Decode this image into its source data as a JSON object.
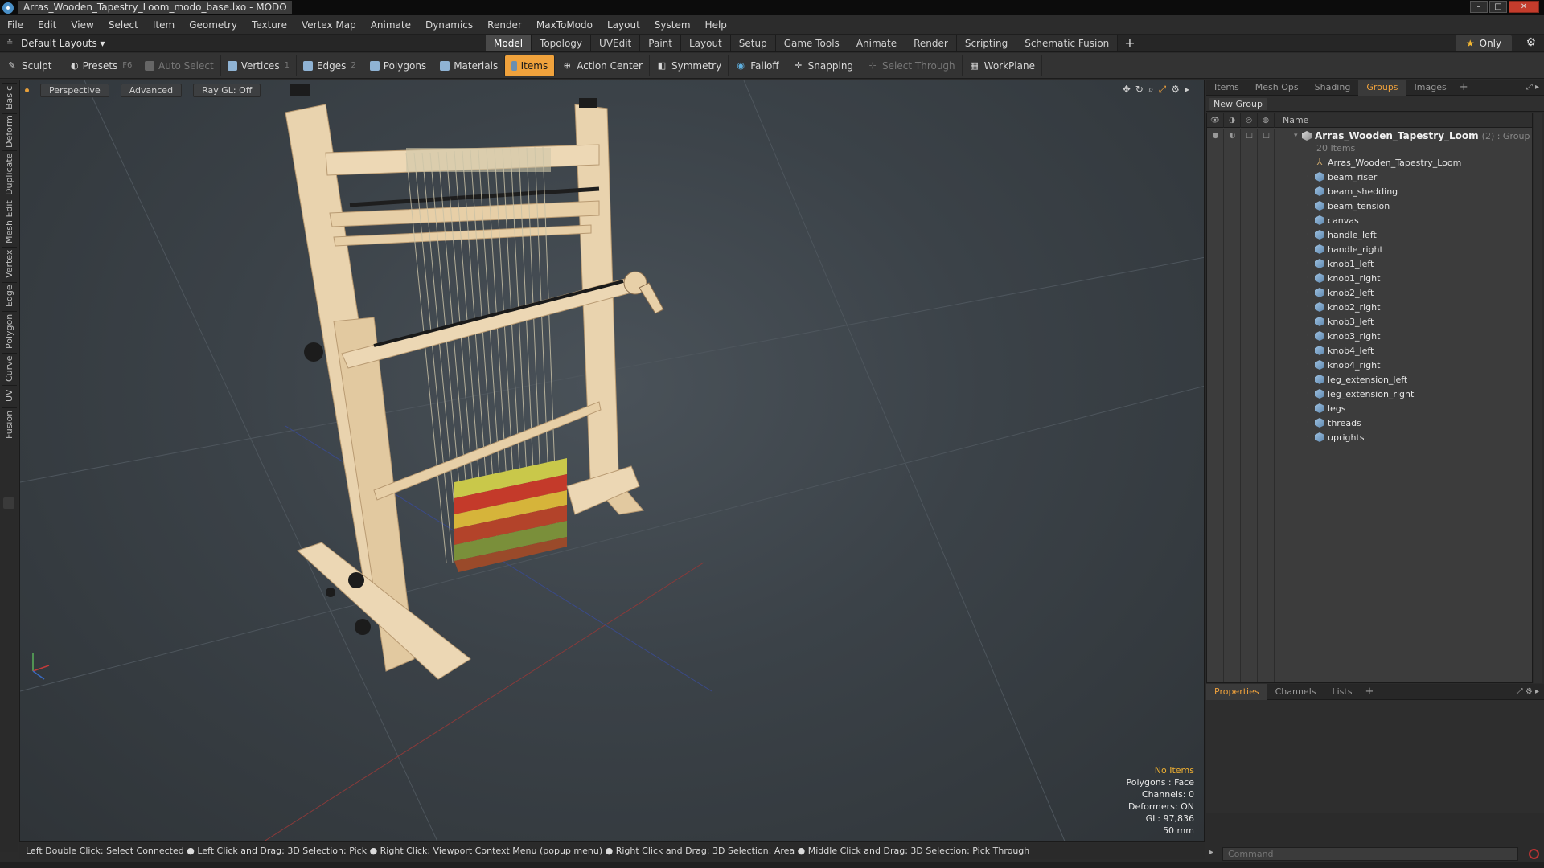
{
  "window": {
    "title": "Arras_Wooden_Tapestry_Loom_modo_base.lxo - MODO",
    "minimize": "–",
    "maximize": "□",
    "close": "✕"
  },
  "menu": [
    "File",
    "Edit",
    "View",
    "Select",
    "Item",
    "Geometry",
    "Texture",
    "Vertex Map",
    "Animate",
    "Dynamics",
    "Render",
    "MaxToModo",
    "Layout",
    "System",
    "Help"
  ],
  "layouts": {
    "label": "Default Layouts ▾"
  },
  "tabs": [
    "Model",
    "Topology",
    "UVEdit",
    "Paint",
    "Layout",
    "Setup",
    "Game Tools",
    "Animate",
    "Render",
    "Scripting",
    "Schematic Fusion"
  ],
  "active_tab": "Model",
  "tab_add": "+",
  "only_label": "Only",
  "toolbar": {
    "sculpt": "Sculpt",
    "presets": "Presets",
    "presets_key": "F6",
    "auto_select": "Auto Select",
    "vertices": "Vertices",
    "vertices_key": "1",
    "edges": "Edges",
    "edges_key": "2",
    "polygons": "Polygons",
    "materials": "Materials",
    "items": "Items",
    "action_center": "Action Center",
    "symmetry": "Symmetry",
    "falloff": "Falloff",
    "snapping": "Snapping",
    "select_through": "Select Through",
    "workplane": "WorkPlane"
  },
  "left_tabs": [
    "Basic",
    "Deform",
    "Duplicate",
    "Mesh Edit",
    "Vertex",
    "Edge",
    "Polygon",
    "Curve",
    "UV",
    "Fusion"
  ],
  "viewport": {
    "perspective": "Perspective",
    "advanced": "Advanced",
    "raygl": "Ray GL: Off",
    "info": {
      "no_items": "No Items",
      "polygons": "Polygons : Face",
      "channels": "Channels: 0",
      "deformers": "Deformers: ON",
      "gl": "GL: 97,836",
      "focal": "50 mm"
    }
  },
  "right_tabs": [
    "Items",
    "Mesh Ops",
    "Shading",
    "Groups",
    "Images"
  ],
  "right_active": "Groups",
  "new_group": "New Group",
  "tree": {
    "name_header": "Name",
    "group": {
      "name": "Arras_Wooden_Tapestry_Loom",
      "count": "(2) : Group",
      "items": "20 Items"
    },
    "children": [
      "Arras_Wooden_Tapestry_Loom",
      "beam_riser",
      "beam_shedding",
      "beam_tension",
      "canvas",
      "handle_left",
      "handle_right",
      "knob1_left",
      "knob1_right",
      "knob2_left",
      "knob2_right",
      "knob3_left",
      "knob3_right",
      "knob4_left",
      "knob4_right",
      "leg_extension_left",
      "leg_extension_right",
      "legs",
      "threads",
      "uprights"
    ]
  },
  "props_tabs": [
    "Properties",
    "Channels",
    "Lists"
  ],
  "props_active": "Properties",
  "status": "Left Double Click: Select Connected ● Left Click and Drag: 3D Selection: Pick ● Right Click: Viewport Context Menu (popup menu) ● Right Click and Drag: 3D Selection: Area ● Middle Click and Drag: 3D Selection: Pick Through",
  "command": {
    "placeholder": "Command"
  },
  "colors": {
    "accent": "#f0a23c",
    "wood": "#e8cfa8",
    "viewport_bg": "#3b4248"
  }
}
